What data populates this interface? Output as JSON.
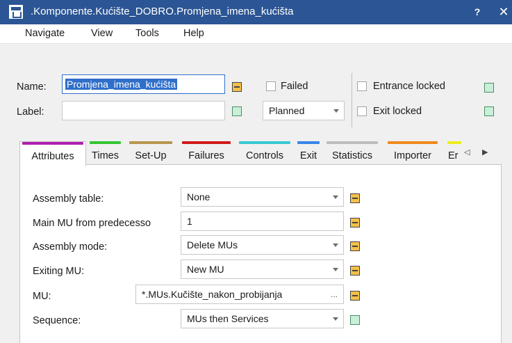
{
  "window": {
    "title": ".Komponente.Kućište_DOBRO.Promjena_imena_kućišta",
    "help_label": "?",
    "close_label": "✕"
  },
  "menu": {
    "items": [
      "Navigate",
      "View",
      "Tools",
      "Help"
    ]
  },
  "header": {
    "name_label": "Name:",
    "name_value": "Promjena_imena_kućišta",
    "label_label": "Label:",
    "label_value": "",
    "failed_label": "Failed",
    "failed_checked": false,
    "planned_value": "Planned",
    "entrance_locked_label": "Entrance locked",
    "entrance_locked_checked": false,
    "exit_locked_label": "Exit locked",
    "exit_locked_checked": false
  },
  "tabs": [
    {
      "label": "Attributes",
      "color": "#b01fb0",
      "active": true
    },
    {
      "label": "Times",
      "color": "#33c533"
    },
    {
      "label": "Set-Up",
      "color": "#b7964f"
    },
    {
      "label": "Failures",
      "color": "#d11a1a"
    },
    {
      "label": "Controls",
      "color": "#36c9d2"
    },
    {
      "label": "Exit",
      "color": "#3a85e8"
    },
    {
      "label": "Statistics",
      "color": "#bdbdbd"
    },
    {
      "label": "Importer",
      "color": "#f08a1c"
    },
    {
      "label": "Er",
      "color": "#eded1f"
    }
  ],
  "tab_scroll": {
    "left": "◁",
    "right": "▶"
  },
  "attributes": {
    "assembly_table_label": "Assembly table:",
    "assembly_table_value": "None",
    "main_mu_label": "Main MU from predecesso",
    "main_mu_value": "1",
    "assembly_mode_label": "Assembly mode:",
    "assembly_mode_value": "Delete MUs",
    "exiting_mu_label": "Exiting MU:",
    "exiting_mu_value": "New MU",
    "mu_label": "MU:",
    "mu_value": "*.MUs.Kučište_nakon_probijanja",
    "mu_browse": "...",
    "sequence_label": "Sequence:",
    "sequence_value": "MUs then Services"
  },
  "colors": {
    "titlebar": "#2b5594",
    "selection": "#2f6fca",
    "indicator_orange": "#f4c04b",
    "indicator_green": "#c9efd8"
  }
}
